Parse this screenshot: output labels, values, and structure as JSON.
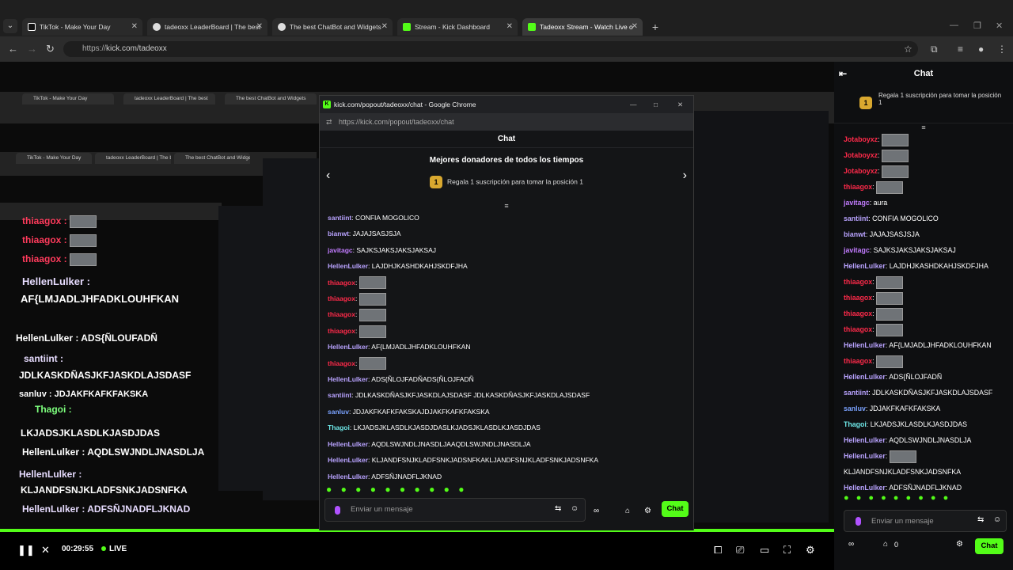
{
  "browser": {
    "tabs": [
      {
        "title": "TikTok - Make Your Day",
        "icon": "tiktok-icon"
      },
      {
        "title": "tadeoxx LeaderBoard | The best",
        "icon": "leaderboard-icon"
      },
      {
        "title": "The best ChatBot and Widgets",
        "icon": "chatbot-icon"
      },
      {
        "title": "Stream - Kick Dashboard",
        "icon": "kick-icon"
      },
      {
        "title": "Tadeoxx Stream - Watch Live o",
        "icon": "kick-icon"
      }
    ],
    "url_scheme": "https://",
    "url_host": "kick.com/tadeoxx"
  },
  "popup": {
    "window_title": "kick.com/popout/tadeoxx/chat - Google Chrome",
    "url": "https://kick.com/popout/tadeoxx/chat",
    "chat_header": "Chat",
    "donors_title": "Mejores donadores de todos los tiempos",
    "pinned_rank": "1",
    "pinned_text": "Regala 1 suscripción para tomar la posición 1",
    "messages": [
      {
        "user": "santiint",
        "text": "CONFIA MOGOLICO",
        "color": "u-violet"
      },
      {
        "user": "bianwt",
        "text": "JAJAJSASJSJA",
        "color": "u-violet"
      },
      {
        "user": "javitagc",
        "text": "SAJKSJAKSJAKSJAKSAJ",
        "color": "u-purple"
      },
      {
        "user": "HellenLulker",
        "text": "LAJDHJKASHDKAHJSKDFJHA",
        "color": "u-violet"
      },
      {
        "user": "thiaagox",
        "text": "",
        "color": "u-red"
      },
      {
        "user": "thiaagox",
        "text": "",
        "color": "u-red"
      },
      {
        "user": "thiaagox",
        "text": "",
        "color": "u-red"
      },
      {
        "user": "thiaagox",
        "text": "",
        "color": "u-red"
      },
      {
        "user": "HellenLulker",
        "text": "AF{LMJADLJHFADKLOUHFKAN",
        "color": "u-violet"
      },
      {
        "user": "thiaagox",
        "text": "",
        "color": "u-red"
      },
      {
        "user": "HellenLulker",
        "text": "ADS{ÑLOJFADÑADS{ÑLOJFADÑ",
        "color": "u-violet"
      },
      {
        "user": "santiint",
        "text": "JDLKASKDÑASJKFJASKDLAJSDASF JDLKASKDÑASJKFJASKDLAJSDASF",
        "color": "u-violet"
      },
      {
        "user": "sanluv",
        "text": "JDJAKFKAFKFAKSKAJDJAKFKAFKFAKSKA",
        "color": "u-blue"
      },
      {
        "user": "Thagoi",
        "text": "LKJADSJKLASDLKJASDJDASLKJADSJKLASDLKJASDJDAS",
        "color": "u-teal"
      },
      {
        "user": "HellenLulker",
        "text": "AQDLSWJNDLJNASDLJAAQDLSWJNDLJNASDLJA",
        "color": "u-violet"
      },
      {
        "user": "HellenLulker",
        "text": "KLJANDFSNJKLADFSNKJADSNFKAKLJANDFSNJKLADFSNKJADSNFKA",
        "color": "u-violet"
      },
      {
        "user": "HellenLulker",
        "text": "ADFSÑJNADFLJKNAD",
        "color": "u-violet"
      }
    ],
    "input_placeholder": "Enviar un mensaje",
    "chat_button": "Chat"
  },
  "sidebar": {
    "header": "Chat",
    "pinned_rank": "1",
    "pinned_text": "Regala 1 suscripción para tomar la posición 1",
    "messages": [
      {
        "user": "Jotaboyxz",
        "text": "",
        "color": "u-red"
      },
      {
        "user": "Jotaboyxz",
        "text": "",
        "color": "u-red"
      },
      {
        "user": "Jotaboyxz",
        "text": "",
        "color": "u-red"
      },
      {
        "user": "thiaagox",
        "text": "",
        "color": "u-red"
      },
      {
        "user": "javitagc",
        "text": "aura",
        "color": "u-purple"
      },
      {
        "user": "santiint",
        "text": "CONFIA MOGOLICO",
        "color": "u-violet"
      },
      {
        "user": "bianwt",
        "text": "JAJAJSASJSJA",
        "color": "u-violet"
      },
      {
        "user": "javitagc",
        "text": "SAJKSJAKSJAKSJAKSAJ",
        "color": "u-purple"
      },
      {
        "user": "HellenLulker",
        "text": "LAJDHJKASHDKAHJSKDFJHA",
        "color": "u-violet"
      },
      {
        "user": "thiaagox",
        "text": "",
        "color": "u-red"
      },
      {
        "user": "thiaagox",
        "text": "",
        "color": "u-red"
      },
      {
        "user": "thiaagox",
        "text": "",
        "color": "u-red"
      },
      {
        "user": "thiaagox",
        "text": "",
        "color": "u-red"
      },
      {
        "user": "HellenLulker",
        "text": "AF{LMJADLJHFADKLOUHFKAN",
        "color": "u-violet"
      },
      {
        "user": "thiaagox",
        "text": "",
        "color": "u-red"
      },
      {
        "user": "HellenLulker",
        "text": "ADS{ÑLOJFADÑ",
        "color": "u-violet"
      },
      {
        "user": "santiint",
        "text": "JDLKASKDÑASJKFJASKDLAJSDASF",
        "color": "u-violet"
      },
      {
        "user": "sanluv",
        "text": "JDJAKFKAFKFAKSKA",
        "color": "u-blue"
      },
      {
        "user": "Thagoi",
        "text": "LKJADSJKLASDLKJASDJDAS",
        "color": "u-teal"
      },
      {
        "user": "HellenLulker",
        "text": "AQDLSWJNDLJNASDLJA",
        "color": "u-violet"
      },
      {
        "user": "HellenLulker",
        "text": "",
        "color": "u-violet"
      },
      {
        "user": "",
        "text": "KLJANDFSNJKLADFSNKJADSNFKA",
        "color": "u-violet"
      },
      {
        "user": "HellenLulker",
        "text": "ADFSÑJNADFLJKNAD",
        "color": "u-violet"
      }
    ],
    "input_placeholder": "Enviar un mensaje",
    "count": "0",
    "chat_button": "Chat"
  },
  "player": {
    "time": "00:29:55",
    "live_label": "LIVE"
  },
  "ghost_chat": {
    "lines": [
      "thiaagox :",
      "thiaagox :",
      "thiaagox :",
      "HellenLulker :",
      "AF{LMJADLJHFADKLOUHFKAN",
      "HellenLulker : ADS{ÑLOUFADÑ",
      "santiint :",
      "JDLKASKDÑASJKFJASKDLAJSDASF",
      "sanluv : JDJAKFKAFKFAKSKA",
      "Thagoi :",
      "LKJADSJKLASDLKJASDJDAS",
      "HellenLulker : AQDLSWJNDLJNASDLJA",
      "HellenLulker :",
      "KLJANDFSNJKLADFSNKJADSNFKA",
      "HellenLulker : ADFSÑJNADFLJKNAD"
    ]
  },
  "colors": {
    "accent": "#53fc18",
    "background": "#0e0f11"
  }
}
